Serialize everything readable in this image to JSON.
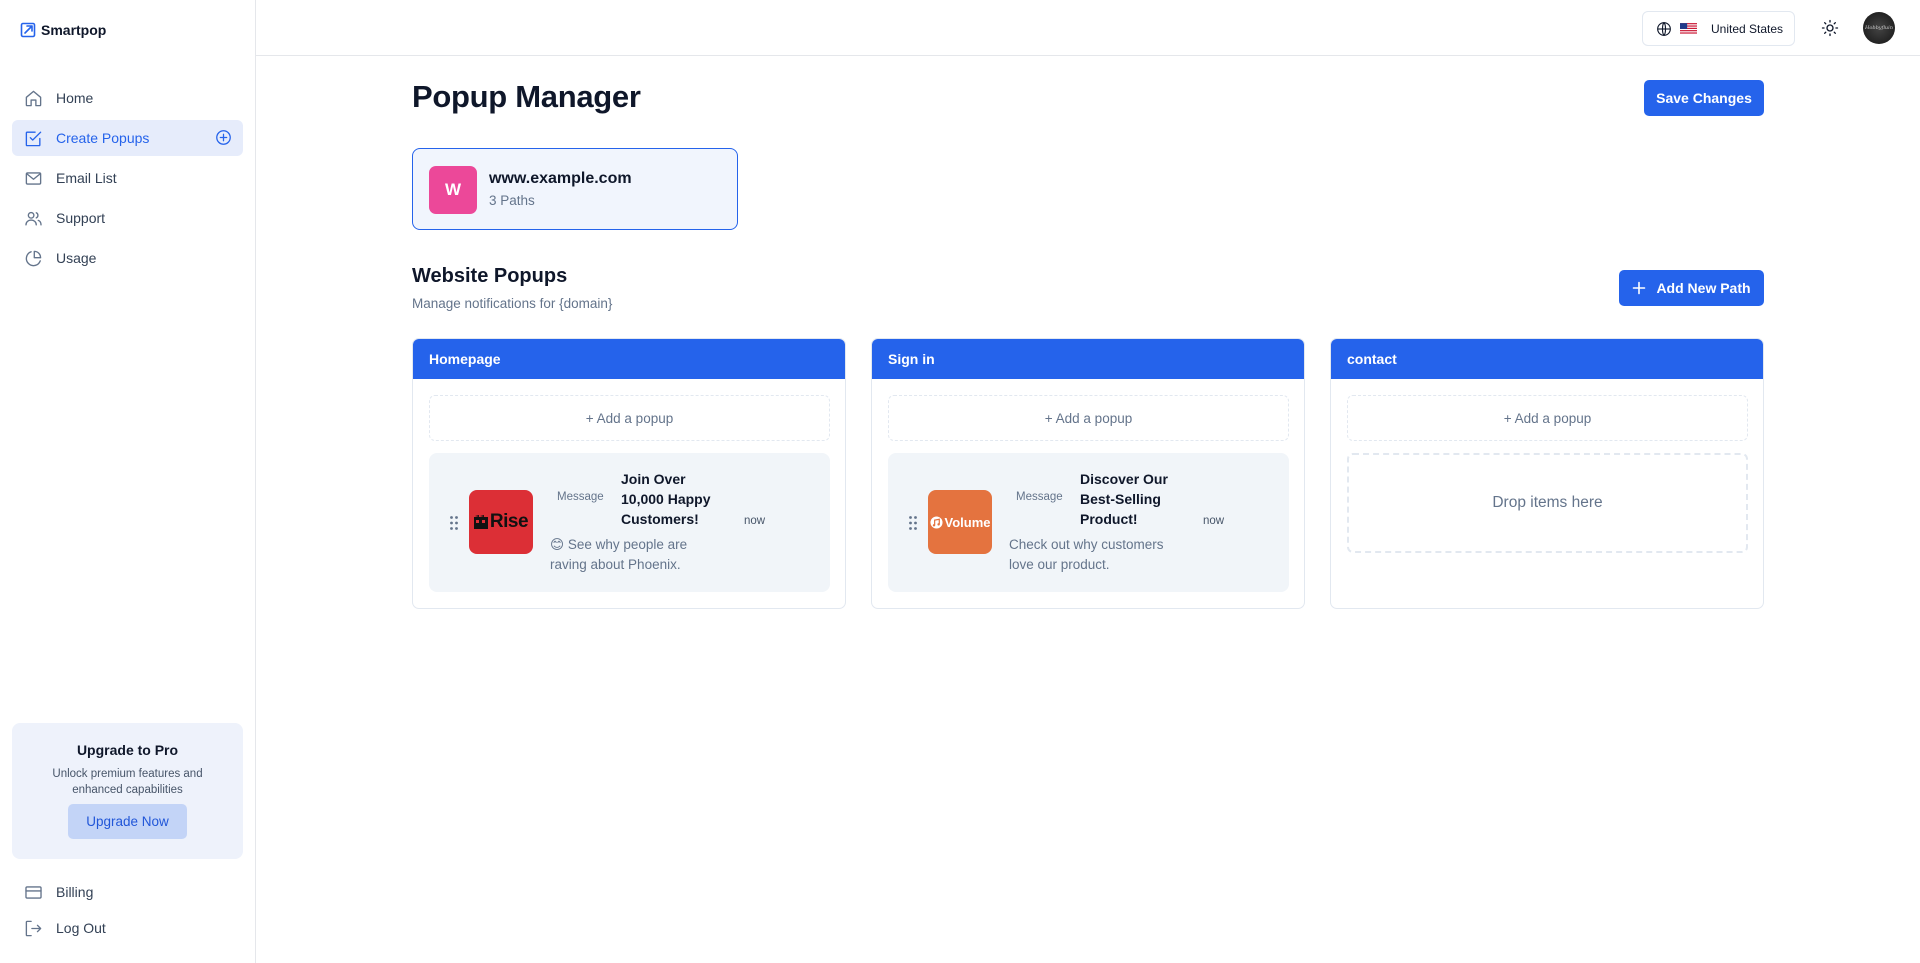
{
  "app": {
    "brand": "Smartpop"
  },
  "sidebar": {
    "items": [
      {
        "label": "Home",
        "icon": "home-icon"
      },
      {
        "label": "Create Popups",
        "icon": "checkbox-edit-icon",
        "active": true
      },
      {
        "label": "Email List",
        "icon": "mail-icon"
      },
      {
        "label": "Support",
        "icon": "users-icon"
      },
      {
        "label": "Usage",
        "icon": "pie-chart-icon"
      }
    ],
    "upgrade": {
      "title": "Upgrade to Pro",
      "description": "Unlock premium features and enhanced capabilities",
      "button": "Upgrade Now"
    },
    "bottom_items": [
      {
        "label": "Billing",
        "icon": "credit-card-icon"
      },
      {
        "label": "Log Out",
        "icon": "log-out-icon"
      }
    ]
  },
  "topbar": {
    "locale": "United States",
    "flag": "us-flag-icon",
    "theme_icon": "sun-icon",
    "avatar_text": "Hobbyfluin"
  },
  "main": {
    "title": "Popup Manager",
    "save_button": "Save Changes",
    "site": {
      "initial": "W",
      "domain": "www.example.com",
      "paths": "3 Paths"
    },
    "section": {
      "title": "Website Popups",
      "subtitle": "Manage notifications for {domain}",
      "add_button": "Add New Path"
    },
    "columns": [
      {
        "name": "Homepage",
        "add_label": "+ Add a popup",
        "popup": {
          "logo_text": "Rise",
          "type": "Message",
          "title": "Join Over 10,000 Happy Customers!",
          "message": "😊 See why people are raving about Phoenix.",
          "time": "now"
        }
      },
      {
        "name": "Sign in",
        "add_label": "+ Add a popup",
        "popup": {
          "logo_text": "Volume",
          "type": "Message",
          "title": "Discover Our Best-Selling Product!",
          "message": "Check out why customers love our product.",
          "time": "now"
        }
      },
      {
        "name": "contact",
        "add_label": "+ Add a popup",
        "drop_label": "Drop items here"
      }
    ]
  },
  "colors": {
    "accent": "#2563eb",
    "site_badge": "#ec4899",
    "rise_logo": "#dc2f36",
    "volume_logo": "#e4733f"
  }
}
